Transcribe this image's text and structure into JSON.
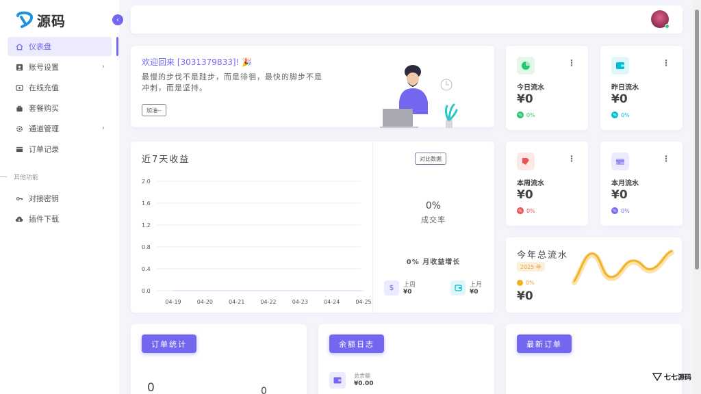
{
  "brand": {
    "name": "源码"
  },
  "sidebar": {
    "items": [
      {
        "label": "仪表盘",
        "icon": "home-icon"
      },
      {
        "label": "账号设置",
        "icon": "user-card-icon"
      },
      {
        "label": "在线充值",
        "icon": "wallet-icon"
      },
      {
        "label": "套餐购买",
        "icon": "bag-icon"
      },
      {
        "label": "通道管理",
        "icon": "gear-icon"
      },
      {
        "label": "订单记录",
        "icon": "card-icon"
      }
    ],
    "section_title": "其他功能",
    "other_items": [
      {
        "label": "对接密钥",
        "icon": "key-icon"
      },
      {
        "label": "插件下载",
        "icon": "cloud-download-icon"
      }
    ]
  },
  "welcome": {
    "title": "欢迎回来 [3031379833]! 🎉",
    "text": "最慢的步伐不是跬步，而是徘徊，最快的脚步不是冲刺，而是坚持。",
    "button": "加油--"
  },
  "stats": [
    {
      "label": "今日流水",
      "value": "¥0",
      "pct": "0%",
      "color": "#28c76f",
      "bg": "#e0f7e9",
      "icon": "pie-chart-icon"
    },
    {
      "label": "昨日流水",
      "value": "¥0",
      "pct": "0%",
      "color": "#00bcd4",
      "bg": "#dff7fb",
      "icon": "wallet-icon"
    },
    {
      "label": "本周流水",
      "value": "¥0",
      "pct": "0%",
      "color": "#ea5455",
      "bg": "#fde7e7",
      "icon": "tag-icon"
    },
    {
      "label": "本月流水",
      "value": "¥0",
      "pct": "0%",
      "color": "#7367f0",
      "bg": "#eceafd",
      "icon": "credit-card-icon"
    }
  ],
  "chart": {
    "title": "近7天收益",
    "compare_button": "对比数据",
    "rate_value": "0%",
    "rate_label": "成交率",
    "growth": "0% 月收益增长",
    "last_week_label": "上周",
    "last_week_value": "¥0",
    "last_month_label": "上月",
    "last_month_value": "¥0"
  },
  "chart_data": {
    "type": "line",
    "title": "近7天收益",
    "categories": [
      "04-19",
      "04-20",
      "04-21",
      "04-22",
      "04-23",
      "04-24",
      "04-25"
    ],
    "values": [
      0,
      0,
      0,
      0,
      0,
      0,
      0
    ],
    "yticks": [
      "2.0",
      "1.6",
      "1.2",
      "0.8",
      "0.4",
      "0.0"
    ],
    "ylim": [
      0,
      2
    ],
    "grid": true
  },
  "year": {
    "title": "今年总流水",
    "badge": "2025 年",
    "pct": "0%",
    "value": "¥0"
  },
  "bottom": {
    "orders_title": "订单统计",
    "orders_value_a": "0",
    "orders_value_b": "0",
    "balance_title": "余额日志",
    "balance_label": "总余额",
    "balance_value": "¥0.00",
    "latest_title": "最新订单"
  },
  "watermark": "七七源码"
}
